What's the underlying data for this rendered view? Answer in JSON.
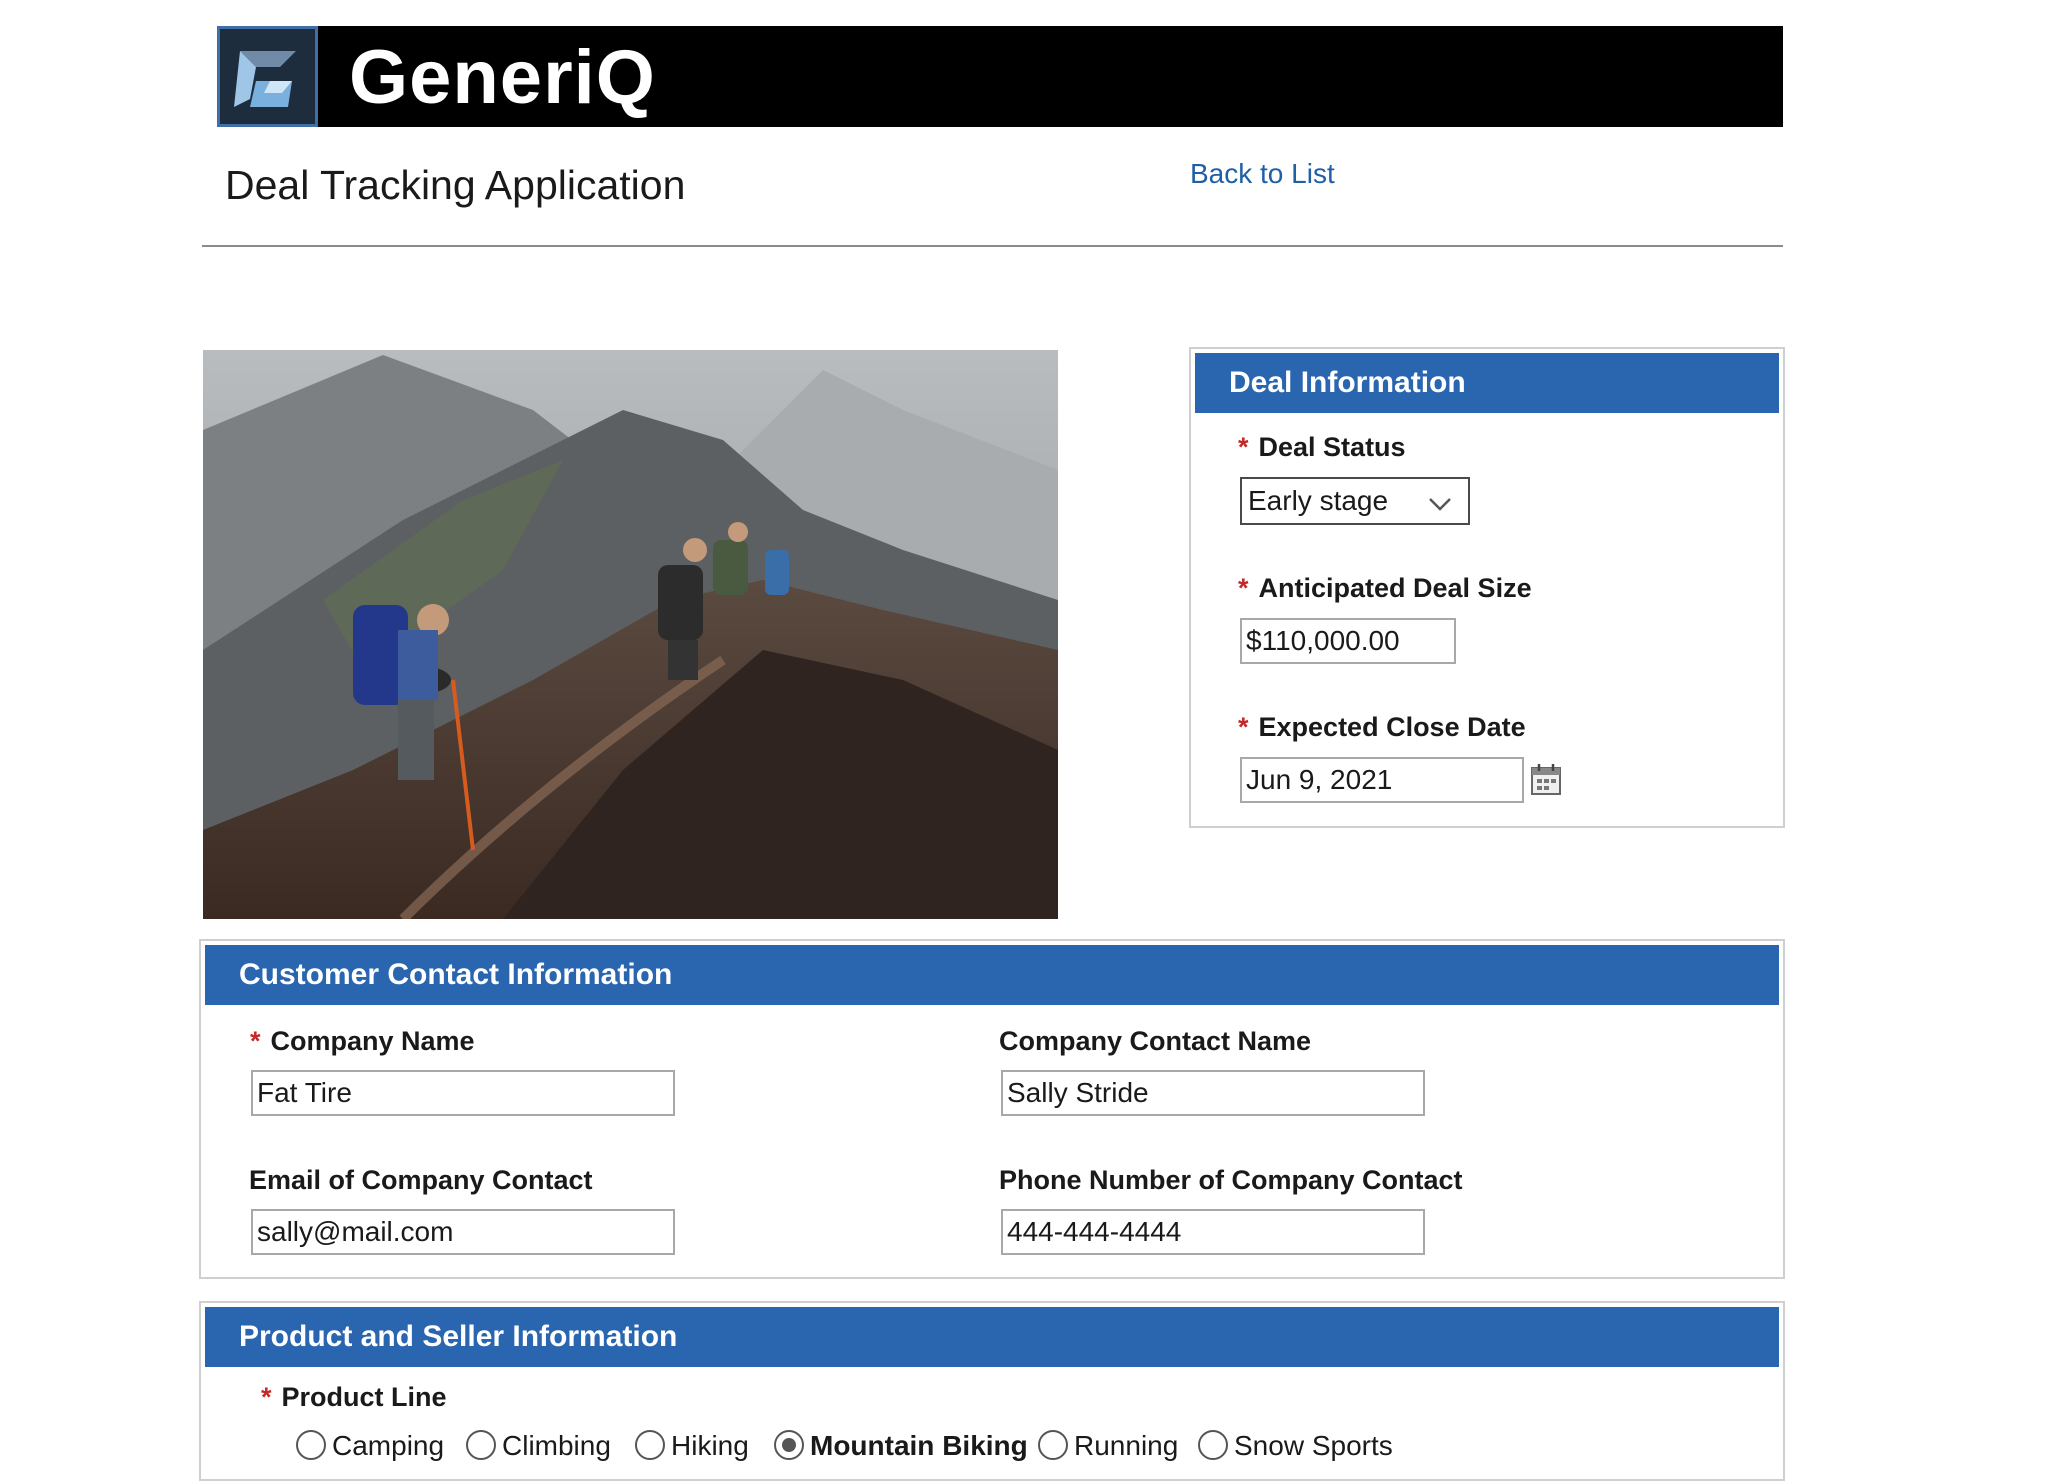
{
  "header": {
    "brand": "GeneriQ",
    "app_title": "Deal Tracking Application",
    "back_link": "Back to List"
  },
  "deal_info": {
    "title": "Deal Information",
    "status_label": "Deal Status",
    "status_value": "Early stage",
    "size_label": "Anticipated Deal Size",
    "size_value": "$110,000.00",
    "close_label": "Expected Close Date",
    "close_value": "Jun 9, 2021"
  },
  "customer": {
    "title": "Customer Contact Information",
    "company_label": "Company Name",
    "company_value": "Fat Tire",
    "contact_label": "Company Contact Name",
    "contact_value": "Sally Stride",
    "email_label": "Email of Company Contact",
    "email_value": "sally@mail.com",
    "phone_label": "Phone Number of Company Contact",
    "phone_value": "444-444-4444"
  },
  "product": {
    "title": "Product and Seller Information",
    "line_label": "Product Line",
    "options": [
      "Camping",
      "Climbing",
      "Hiking",
      "Mountain Biking",
      "Running",
      "Snow Sports"
    ],
    "selected": "Mountain Biking"
  },
  "colors": {
    "accent": "#2a66b0",
    "link": "#1f5fa6",
    "required": "#c62828",
    "banner": "#000000"
  },
  "icons": {
    "logo": "generiq-logo-icon",
    "dropdown": "chevron-down-icon",
    "calendar": "calendar-icon"
  }
}
